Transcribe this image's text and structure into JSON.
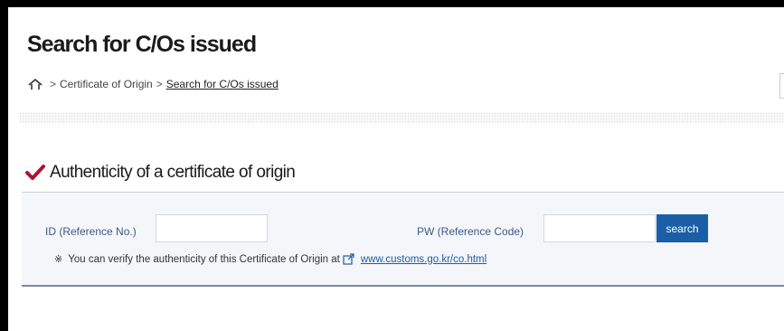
{
  "header": {
    "title": "Search for C/Os issued"
  },
  "breadcrumb": {
    "items": [
      "Certificate of Origin",
      "Search for C/Os issued"
    ],
    "separator": ">"
  },
  "section": {
    "title": "Authenticity of a certificate of origin"
  },
  "search_form": {
    "id_label": "ID (Reference No.)",
    "id_value": "",
    "pw_label": "PW (Reference Code)",
    "pw_value": "",
    "search_label": "search"
  },
  "notice": {
    "mark": "※",
    "text": "You can verify the authenticity of this Certificate of Origin at",
    "link_text": "www.customs.go.kr/co.html"
  },
  "colors": {
    "accent": "#1a5ea8",
    "check": "#b3122c",
    "label": "#3c5a8a"
  }
}
